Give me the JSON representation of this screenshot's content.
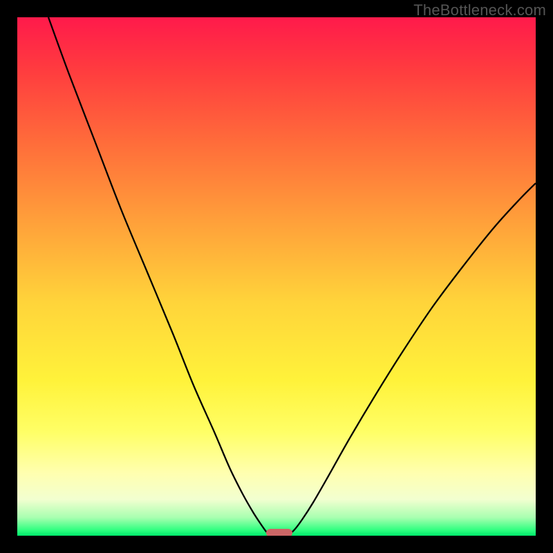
{
  "watermark": "TheBottleneck.com",
  "chart_data": {
    "type": "line",
    "title": "",
    "xlabel": "",
    "ylabel": "",
    "xlim": [
      0,
      100
    ],
    "ylim": [
      0,
      100
    ],
    "grid": false,
    "legend": false,
    "background_gradient_stops": [
      {
        "pos": 0.0,
        "color": "#ff1a4b"
      },
      {
        "pos": 0.1,
        "color": "#ff3b3f"
      },
      {
        "pos": 0.25,
        "color": "#ff6f3a"
      },
      {
        "pos": 0.4,
        "color": "#ffa23a"
      },
      {
        "pos": 0.55,
        "color": "#ffd43a"
      },
      {
        "pos": 0.7,
        "color": "#fff23a"
      },
      {
        "pos": 0.8,
        "color": "#ffff66"
      },
      {
        "pos": 0.88,
        "color": "#ffffb0"
      },
      {
        "pos": 0.93,
        "color": "#f2ffd0"
      },
      {
        "pos": 0.965,
        "color": "#a8ffb0"
      },
      {
        "pos": 0.99,
        "color": "#2bff7e"
      },
      {
        "pos": 1.0,
        "color": "#00e86b"
      }
    ],
    "series": [
      {
        "name": "left-branch",
        "x": [
          6,
          10,
          15,
          20,
          25,
          30,
          34,
          38,
          41,
          43.5,
          45.5,
          47,
          48,
          48.7
        ],
        "y": [
          100,
          89,
          76,
          63,
          51,
          39,
          29,
          20,
          13,
          8,
          4.5,
          2.2,
          0.8,
          0.1
        ]
      },
      {
        "name": "right-branch",
        "x": [
          52.3,
          53.5,
          55,
          57,
          60,
          64,
          69,
          74,
          80,
          86,
          92,
          97,
          100
        ],
        "y": [
          0.1,
          1.2,
          3.2,
          6.3,
          11.5,
          18.6,
          27.0,
          35.0,
          44.0,
          52.0,
          59.5,
          65.0,
          68.0
        ]
      }
    ],
    "marker": {
      "x": 50.5,
      "y": 0.5,
      "w": 5.0,
      "h": 1.6,
      "color": "#cc6666"
    }
  }
}
